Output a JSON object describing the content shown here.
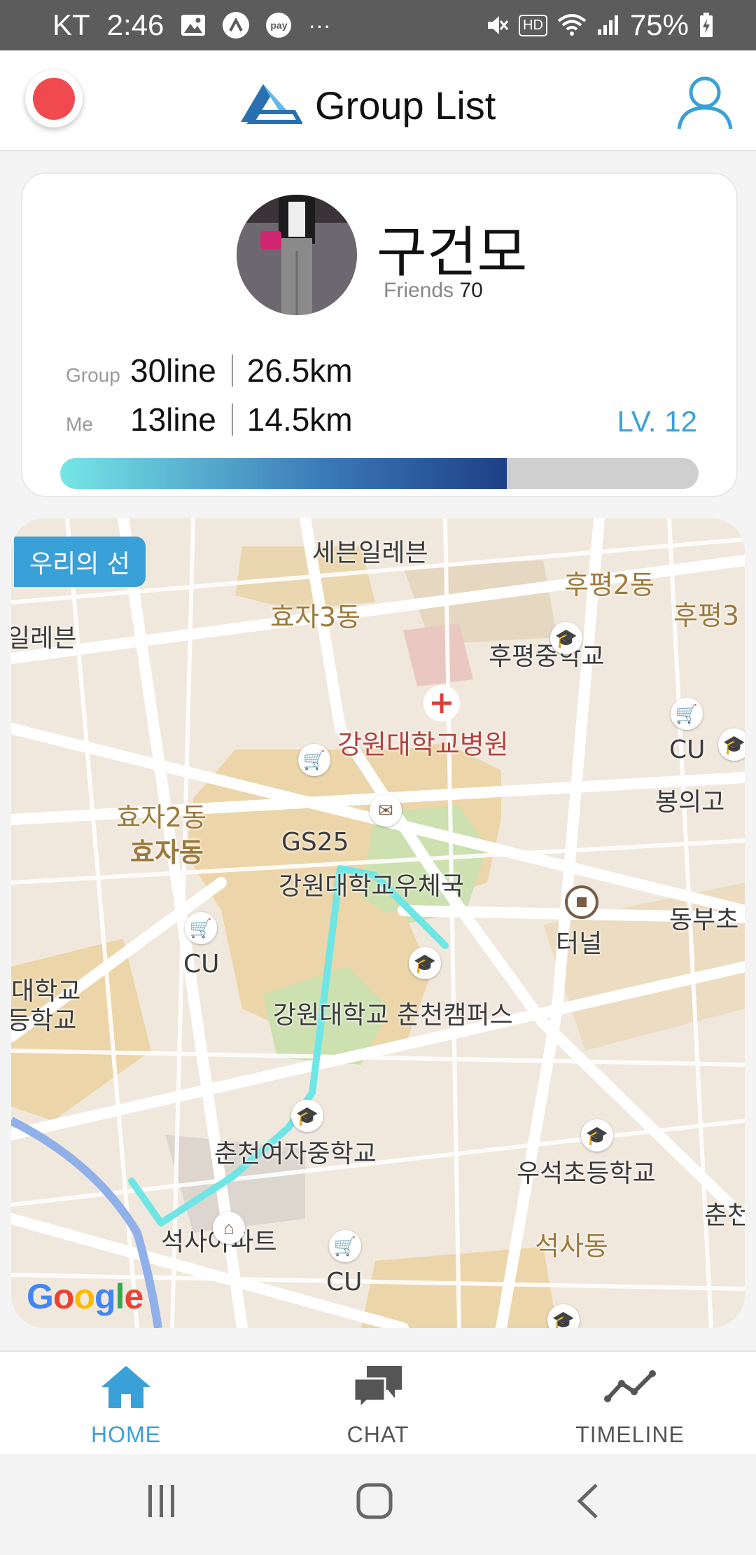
{
  "status_bar": {
    "carrier": "KT",
    "time": "2:46",
    "app_icons": [
      "gallery-icon",
      "a-icon",
      "pay-icon",
      "more-icon"
    ],
    "pay_text": "pay",
    "more_text": "···",
    "hd_text": "HD",
    "battery": "75%"
  },
  "header": {
    "title": "Group List"
  },
  "profile": {
    "name": "구건모",
    "friends_label": "Friends",
    "friends_count": "70",
    "group_label": "Group",
    "group_lines": "30line",
    "group_km": "26.5km",
    "me_label": "Me",
    "me_lines": "13line",
    "me_km": "14.5km",
    "level": "LV. 12",
    "progress_percent": 70
  },
  "map": {
    "badge": "우리의 선",
    "labels": {
      "seven_eleven": "세븐일레븐",
      "hujeong2": "후평2동",
      "hyoja3": "효자3동",
      "hujeong3": "후평3",
      "eleven_left": "일레븐",
      "hujeong_ms": "후평중학교",
      "hospital": "강원대학교병원",
      "cu_right": "CU",
      "bongui": "봉의고",
      "hyoja2": "효자2동",
      "hyojadong": "효자동",
      "gs25": "GS25",
      "post": "강원대학교우체국",
      "tunnel": "터널",
      "dongbu": "동부초",
      "cu_left": "CU",
      "univ_left1": "대학교",
      "univ_left2": "등학교",
      "campus": "강원대학교 춘천캠퍼스",
      "girls_ms": "춘천여자중학교",
      "useok": "우석초등학교",
      "chuncheon": "춘천",
      "seoksa_apt": "석사아파트",
      "seoksadong": "석사동",
      "cu_bottom": "CU"
    },
    "attribution": "Google"
  },
  "bottom_nav": {
    "items": [
      {
        "label": "HOME",
        "icon": "home-icon",
        "active": true
      },
      {
        "label": "CHAT",
        "icon": "chat-icon",
        "active": false
      },
      {
        "label": "TIMELINE",
        "icon": "timeline-icon",
        "active": false
      }
    ]
  },
  "colors": {
    "accent": "#3aa0d8",
    "record": "#f04a4f",
    "route": "#6fe6e6",
    "status_bar": "#5c5c5c"
  }
}
